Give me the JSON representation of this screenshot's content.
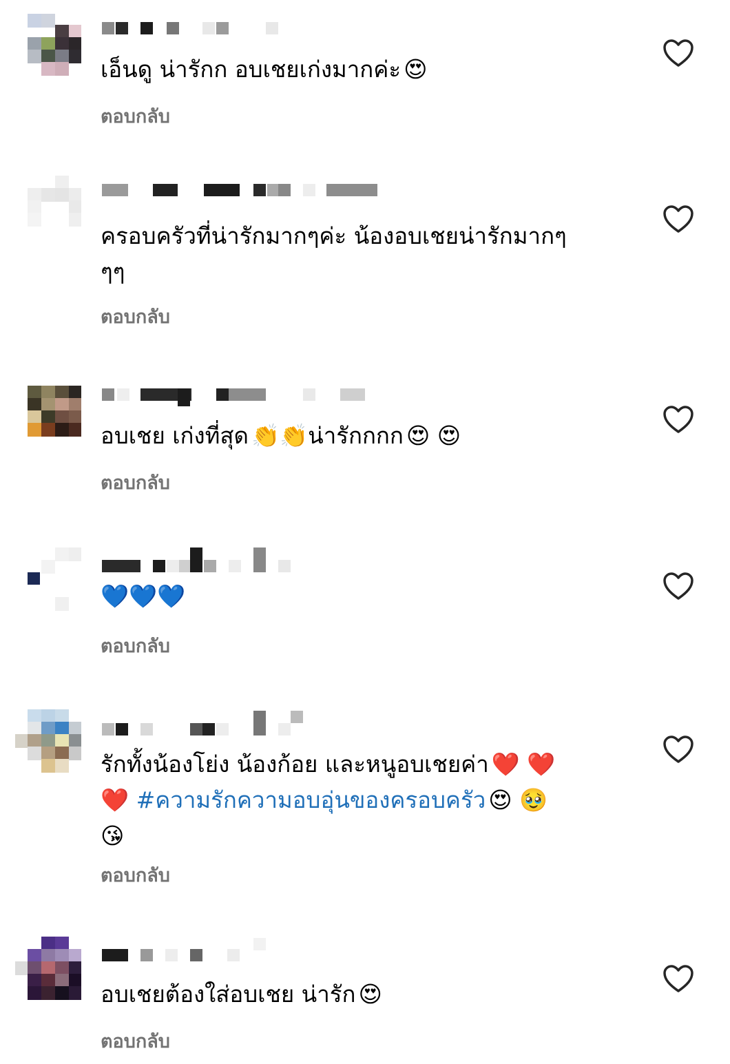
{
  "reply_label": "ตอบกลับ",
  "like_icon": "heart-outline-icon",
  "colors": {
    "reply_text": "#737373",
    "hashtag": "#1f6fb8",
    "body_text": "#000000"
  },
  "comments": [
    {
      "text": "เอ็นดู น่ารักก อบเชยเก่งมากค่ะ",
      "emojis": "😍"
    },
    {
      "text_line1": "ครอบครัวที่น่ารักมากๆค่ะ น้องอบเชยน่ารักมากๆ",
      "text_line2": "ๆๆ"
    },
    {
      "text_a": "อบเชย เก่งที่สุด",
      "emojis_a": "👏👏",
      "text_b": "น่ารักกกก",
      "emojis_b": "😍 😍"
    },
    {
      "emojis": "💙💙💙"
    },
    {
      "text": "รักทั้งน้องโย่ง น้องก้อย และหนูอบเชยค่า",
      "emojis_a": "❤️ ❤️",
      "emojis_b": "❤️",
      "hashtag": "#ความรักความอบอุ่นของครอบครัว",
      "emojis_c": "😍 🥹",
      "emojis_d": "😘"
    },
    {
      "text": "อบเชยต้องใส่อบเชย น่ารัก",
      "emojis": "😍"
    }
  ]
}
